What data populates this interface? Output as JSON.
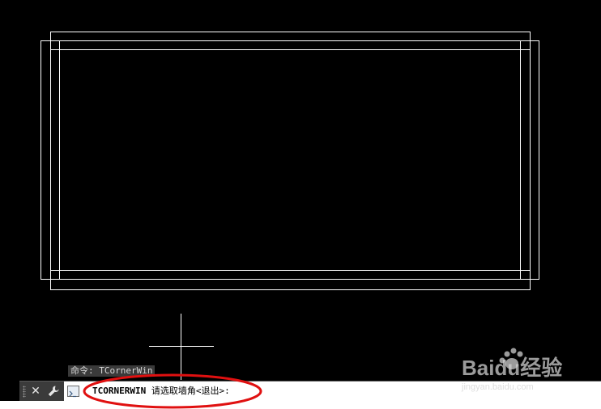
{
  "command_history": {
    "last_command": "命令: TCornerWin"
  },
  "command_line": {
    "close_icon": "close-icon",
    "customize_icon": "wrench-icon",
    "prompt_icon": "command-prompt-icon",
    "command_name": "TCORNERWIN",
    "prompt_text": "请选取墙角<退出>:"
  },
  "watermark": {
    "brand": "Baidu经验",
    "url": "jingyan.baidu.com"
  },
  "colors": {
    "canvas_background": "#000000",
    "geometry_line": "#ffffff",
    "highlight_ellipse": "#e01010",
    "command_bar": "#3b3b3b"
  }
}
